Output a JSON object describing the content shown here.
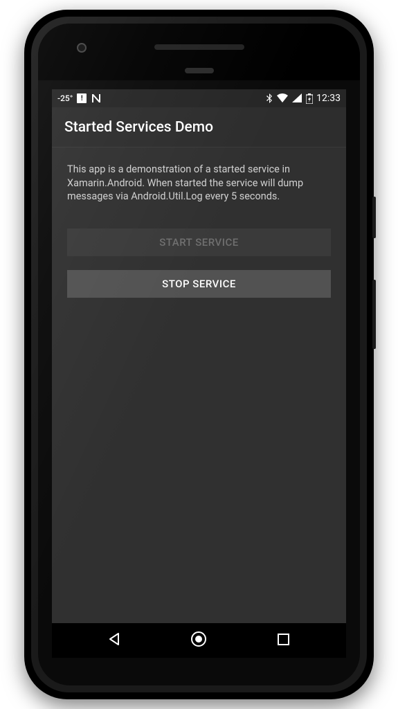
{
  "statusBar": {
    "temperature": "-25°",
    "clock": "12:33"
  },
  "appBar": {
    "title": "Started Services Demo"
  },
  "content": {
    "description": "This app is a demonstration of a started service in Xamarin.Android. When started the service will dump messages via Android.Util.Log every 5 seconds."
  },
  "buttons": {
    "startService": "START SERVICE",
    "stopService": "STOP SERVICE"
  }
}
